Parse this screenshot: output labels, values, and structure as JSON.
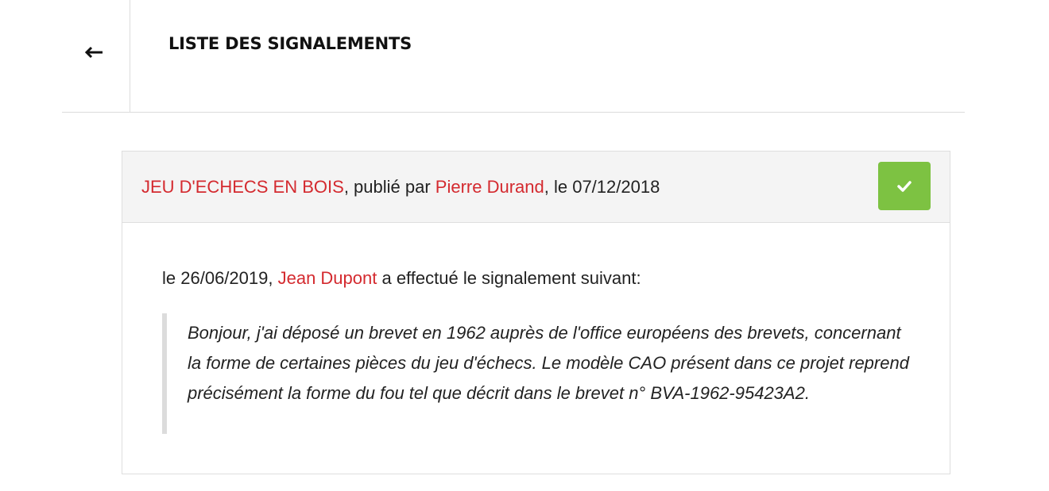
{
  "header": {
    "back_icon": "arrow-left-icon",
    "title": "LISTE DES SIGNALEMENTS"
  },
  "report": {
    "project_name": "JEU D'ECHECS EN BOIS",
    "published_by_text": ", publié par ",
    "author_name": "Pierre Durand",
    "date_prefix": ", le ",
    "published_date": "07/12/2018",
    "resolve_icon": "check-icon",
    "report_prefix": "le ",
    "report_date": "26/06/2019",
    "report_sep": ", ",
    "reporter_name": "Jean Dupont",
    "report_suffix": " a effectué le signalement suivant:",
    "message": "Bonjour, j'ai déposé un brevet en 1962 auprès de l'office européens des brevets, concernant la forme de certaines pièces du jeu d'échecs. Le modèle CAO présent dans ce projet reprend précisément la forme du fou tel que décrit dans le brevet n° BVA-1962-95423A2."
  },
  "colors": {
    "link": "#d42a2f",
    "resolve_button": "#7dc242",
    "card_header_bg": "#f4f4f4",
    "border": "#dedede"
  }
}
